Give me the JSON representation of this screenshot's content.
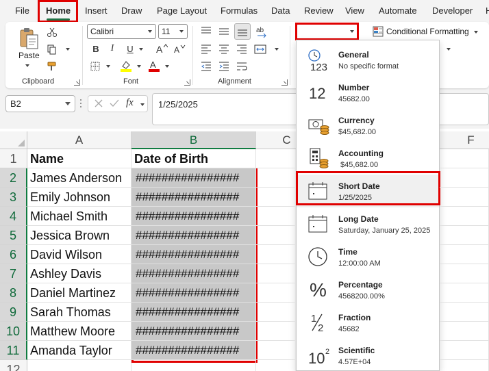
{
  "menu": {
    "tabs": [
      "File",
      "Home",
      "Insert",
      "Draw",
      "Page Layout",
      "Formulas",
      "Data",
      "Review",
      "View",
      "Automate",
      "Developer",
      "H"
    ],
    "active": "Home"
  },
  "ribbon": {
    "clipboard": {
      "paste_label": "Paste",
      "group_label": "Clipboard"
    },
    "font": {
      "font_name": "Calibri",
      "font_size": "11",
      "group_label": "Font",
      "highlight_color": "#ffff00",
      "font_color": "#e00000"
    },
    "alignment": {
      "group_label": "Alignment"
    },
    "number": {
      "format_value": ""
    },
    "styles": {
      "conditional_formatting_label": "Conditional Formatting"
    }
  },
  "formula_bar": {
    "name_box": "B2",
    "fx_label": "fx",
    "formula_value": "1/25/2025"
  },
  "sheet": {
    "columns": [
      "A",
      "B",
      "C",
      "D",
      "E",
      "F"
    ],
    "rows": [
      "1",
      "2",
      "3",
      "4",
      "5",
      "6",
      "7",
      "8",
      "9",
      "10",
      "11",
      "12"
    ],
    "header_row": [
      "Name",
      "Date of Birth"
    ],
    "data_rows": [
      {
        "name": "James Anderson",
        "dob": "################"
      },
      {
        "name": "Emily Johnson",
        "dob": "################"
      },
      {
        "name": "Michael Smith",
        "dob": "################"
      },
      {
        "name": "Jessica Brown",
        "dob": "################"
      },
      {
        "name": "David Wilson",
        "dob": "################"
      },
      {
        "name": "Ashley Davis",
        "dob": "################"
      },
      {
        "name": "Daniel Martinez",
        "dob": "################"
      },
      {
        "name": "Sarah Thomas",
        "dob": "################"
      },
      {
        "name": "Matthew Moore",
        "dob": "################"
      },
      {
        "name": "Amanda Taylor",
        "dob": "################"
      }
    ]
  },
  "number_format_menu": {
    "items": [
      {
        "name": "General",
        "sample": "No specific format",
        "icon": "clock-123-icon"
      },
      {
        "name": "Number",
        "sample": "45682.00",
        "icon": "number-12-icon"
      },
      {
        "name": "Currency",
        "sample": "$45,682.00",
        "icon": "currency-icon"
      },
      {
        "name": "Accounting",
        "sample": " $45,682.00",
        "icon": "accounting-icon"
      },
      {
        "name": "Short Date",
        "sample": "1/25/2025",
        "icon": "calendar-icon"
      },
      {
        "name": "Long Date",
        "sample": "Saturday, January 25, 2025",
        "icon": "calendar-icon"
      },
      {
        "name": "Time",
        "sample": "12:00:00 AM",
        "icon": "clock-icon"
      },
      {
        "name": "Percentage",
        "sample": "4568200.00%",
        "icon": "percent-icon"
      },
      {
        "name": "Fraction",
        "sample": "45682",
        "icon": "fraction-icon"
      },
      {
        "name": "Scientific",
        "sample": "4.57E+04",
        "icon": "scientific-icon"
      }
    ],
    "selected": "Short Date"
  },
  "colors": {
    "highlight_red": "#e00000",
    "excel_green": "#107c41"
  }
}
